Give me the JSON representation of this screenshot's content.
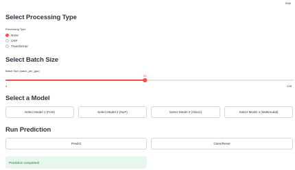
{
  "header": {
    "deploy_label": "Depl"
  },
  "processing": {
    "title": "Select Processing Type",
    "label": "Processing Type",
    "options": [
      {
        "label": "None",
        "selected": true
      },
      {
        "label": "CRF",
        "selected": false
      },
      {
        "label": "Transformer",
        "selected": false
      }
    ]
  },
  "batch": {
    "title": "Select Batch Size",
    "label": "Batch Size (batch_per_gpu)",
    "min": "4",
    "max": "128",
    "value": "64",
    "min_value": 4,
    "max_value": 128,
    "current_value": 64
  },
  "model": {
    "title": "Select a Model",
    "buttons": [
      "Select Model 1 (Font)",
      "Select Model 2 (NLP)",
      "Select Model 3 (Vision)",
      "Select Model 4 (Multimodal)"
    ]
  },
  "run": {
    "title": "Run Prediction",
    "predict_label": "Predict",
    "clear_label": "Clear/Reset",
    "status": "Prediction completed!"
  },
  "colors": {
    "accent": "#ff4b4b",
    "success_bg": "#e8f7ee",
    "success_text": "#177233"
  }
}
